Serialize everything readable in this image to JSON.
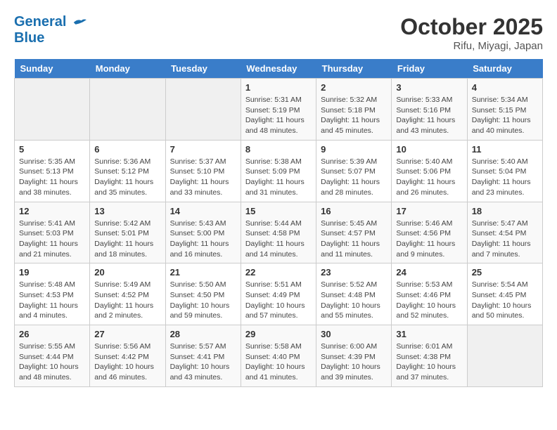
{
  "header": {
    "logo_line1": "General",
    "logo_line2": "Blue",
    "month": "October 2025",
    "location": "Rifu, Miyagi, Japan"
  },
  "weekdays": [
    "Sunday",
    "Monday",
    "Tuesday",
    "Wednesday",
    "Thursday",
    "Friday",
    "Saturday"
  ],
  "weeks": [
    [
      {
        "day": "",
        "empty": true
      },
      {
        "day": "",
        "empty": true
      },
      {
        "day": "",
        "empty": true
      },
      {
        "day": "1",
        "sunrise": "Sunrise: 5:31 AM",
        "sunset": "Sunset: 5:19 PM",
        "daylight": "Daylight: 11 hours and 48 minutes."
      },
      {
        "day": "2",
        "sunrise": "Sunrise: 5:32 AM",
        "sunset": "Sunset: 5:18 PM",
        "daylight": "Daylight: 11 hours and 45 minutes."
      },
      {
        "day": "3",
        "sunrise": "Sunrise: 5:33 AM",
        "sunset": "Sunset: 5:16 PM",
        "daylight": "Daylight: 11 hours and 43 minutes."
      },
      {
        "day": "4",
        "sunrise": "Sunrise: 5:34 AM",
        "sunset": "Sunset: 5:15 PM",
        "daylight": "Daylight: 11 hours and 40 minutes."
      }
    ],
    [
      {
        "day": "5",
        "sunrise": "Sunrise: 5:35 AM",
        "sunset": "Sunset: 5:13 PM",
        "daylight": "Daylight: 11 hours and 38 minutes."
      },
      {
        "day": "6",
        "sunrise": "Sunrise: 5:36 AM",
        "sunset": "Sunset: 5:12 PM",
        "daylight": "Daylight: 11 hours and 35 minutes."
      },
      {
        "day": "7",
        "sunrise": "Sunrise: 5:37 AM",
        "sunset": "Sunset: 5:10 PM",
        "daylight": "Daylight: 11 hours and 33 minutes."
      },
      {
        "day": "8",
        "sunrise": "Sunrise: 5:38 AM",
        "sunset": "Sunset: 5:09 PM",
        "daylight": "Daylight: 11 hours and 31 minutes."
      },
      {
        "day": "9",
        "sunrise": "Sunrise: 5:39 AM",
        "sunset": "Sunset: 5:07 PM",
        "daylight": "Daylight: 11 hours and 28 minutes."
      },
      {
        "day": "10",
        "sunrise": "Sunrise: 5:40 AM",
        "sunset": "Sunset: 5:06 PM",
        "daylight": "Daylight: 11 hours and 26 minutes."
      },
      {
        "day": "11",
        "sunrise": "Sunrise: 5:40 AM",
        "sunset": "Sunset: 5:04 PM",
        "daylight": "Daylight: 11 hours and 23 minutes."
      }
    ],
    [
      {
        "day": "12",
        "sunrise": "Sunrise: 5:41 AM",
        "sunset": "Sunset: 5:03 PM",
        "daylight": "Daylight: 11 hours and 21 minutes."
      },
      {
        "day": "13",
        "sunrise": "Sunrise: 5:42 AM",
        "sunset": "Sunset: 5:01 PM",
        "daylight": "Daylight: 11 hours and 18 minutes."
      },
      {
        "day": "14",
        "sunrise": "Sunrise: 5:43 AM",
        "sunset": "Sunset: 5:00 PM",
        "daylight": "Daylight: 11 hours and 16 minutes."
      },
      {
        "day": "15",
        "sunrise": "Sunrise: 5:44 AM",
        "sunset": "Sunset: 4:58 PM",
        "daylight": "Daylight: 11 hours and 14 minutes."
      },
      {
        "day": "16",
        "sunrise": "Sunrise: 5:45 AM",
        "sunset": "Sunset: 4:57 PM",
        "daylight": "Daylight: 11 hours and 11 minutes."
      },
      {
        "day": "17",
        "sunrise": "Sunrise: 5:46 AM",
        "sunset": "Sunset: 4:56 PM",
        "daylight": "Daylight: 11 hours and 9 minutes."
      },
      {
        "day": "18",
        "sunrise": "Sunrise: 5:47 AM",
        "sunset": "Sunset: 4:54 PM",
        "daylight": "Daylight: 11 hours and 7 minutes."
      }
    ],
    [
      {
        "day": "19",
        "sunrise": "Sunrise: 5:48 AM",
        "sunset": "Sunset: 4:53 PM",
        "daylight": "Daylight: 11 hours and 4 minutes."
      },
      {
        "day": "20",
        "sunrise": "Sunrise: 5:49 AM",
        "sunset": "Sunset: 4:52 PM",
        "daylight": "Daylight: 11 hours and 2 minutes."
      },
      {
        "day": "21",
        "sunrise": "Sunrise: 5:50 AM",
        "sunset": "Sunset: 4:50 PM",
        "daylight": "Daylight: 10 hours and 59 minutes."
      },
      {
        "day": "22",
        "sunrise": "Sunrise: 5:51 AM",
        "sunset": "Sunset: 4:49 PM",
        "daylight": "Daylight: 10 hours and 57 minutes."
      },
      {
        "day": "23",
        "sunrise": "Sunrise: 5:52 AM",
        "sunset": "Sunset: 4:48 PM",
        "daylight": "Daylight: 10 hours and 55 minutes."
      },
      {
        "day": "24",
        "sunrise": "Sunrise: 5:53 AM",
        "sunset": "Sunset: 4:46 PM",
        "daylight": "Daylight: 10 hours and 52 minutes."
      },
      {
        "day": "25",
        "sunrise": "Sunrise: 5:54 AM",
        "sunset": "Sunset: 4:45 PM",
        "daylight": "Daylight: 10 hours and 50 minutes."
      }
    ],
    [
      {
        "day": "26",
        "sunrise": "Sunrise: 5:55 AM",
        "sunset": "Sunset: 4:44 PM",
        "daylight": "Daylight: 10 hours and 48 minutes."
      },
      {
        "day": "27",
        "sunrise": "Sunrise: 5:56 AM",
        "sunset": "Sunset: 4:42 PM",
        "daylight": "Daylight: 10 hours and 46 minutes."
      },
      {
        "day": "28",
        "sunrise": "Sunrise: 5:57 AM",
        "sunset": "Sunset: 4:41 PM",
        "daylight": "Daylight: 10 hours and 43 minutes."
      },
      {
        "day": "29",
        "sunrise": "Sunrise: 5:58 AM",
        "sunset": "Sunset: 4:40 PM",
        "daylight": "Daylight: 10 hours and 41 minutes."
      },
      {
        "day": "30",
        "sunrise": "Sunrise: 6:00 AM",
        "sunset": "Sunset: 4:39 PM",
        "daylight": "Daylight: 10 hours and 39 minutes."
      },
      {
        "day": "31",
        "sunrise": "Sunrise: 6:01 AM",
        "sunset": "Sunset: 4:38 PM",
        "daylight": "Daylight: 10 hours and 37 minutes."
      },
      {
        "day": "",
        "empty": true
      }
    ]
  ]
}
